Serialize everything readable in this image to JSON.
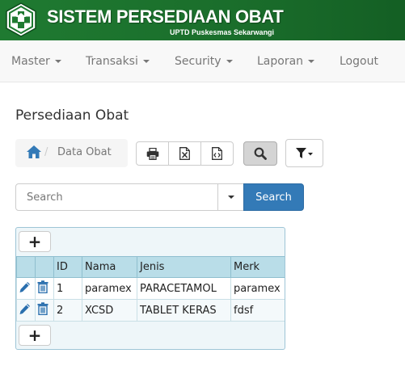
{
  "header": {
    "title": "SISTEM PERSEDIAAN OBAT",
    "subtitle": "UPTD Puskesmas Sekarwangi",
    "logo_icon": "puskesmas-logo-icon",
    "bg_color": "#1f7a31"
  },
  "nav": {
    "items": [
      {
        "label": "Master"
      },
      {
        "label": "Transaksi"
      },
      {
        "label": "Security"
      },
      {
        "label": "Laporan"
      },
      {
        "label": "Logout"
      }
    ]
  },
  "page": {
    "title": "Persediaan Obat"
  },
  "breadcrumb": {
    "sep": "/",
    "current": "Data Obat"
  },
  "toolbar": {
    "icons": [
      "print-icon",
      "excel-export-icon",
      "code-export-icon",
      "search-icon",
      "filter-icon"
    ]
  },
  "search": {
    "placeholder": "Search",
    "button_label": "Search",
    "accent": "#337ab7"
  },
  "grid": {
    "add_label": "+",
    "columns": [
      "",
      "",
      "ID",
      "Nama",
      "Jenis",
      "Merk"
    ],
    "rows": [
      {
        "id": "1",
        "nama": "paramex",
        "jenis": "PARACETAMOL",
        "merk": "paramex"
      },
      {
        "id": "2",
        "nama": "XCSD",
        "jenis": "TABLET KERAS",
        "merk": "fdsf"
      }
    ],
    "header_color": "#b9dde8"
  }
}
